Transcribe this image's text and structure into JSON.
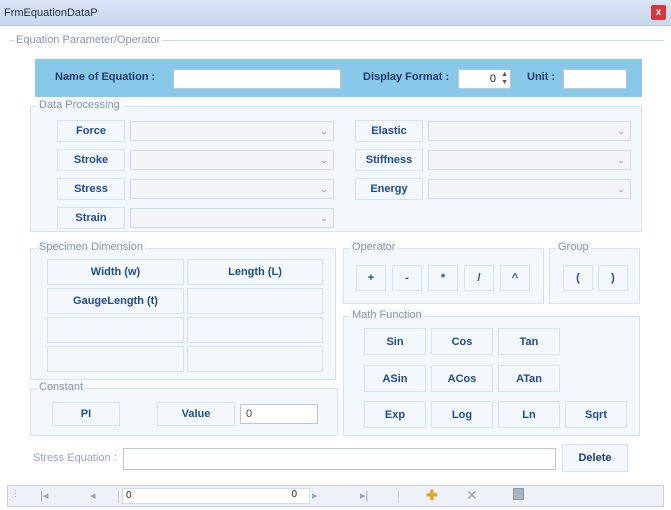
{
  "window": {
    "title": "FrmEquationDataP",
    "close_glyph": "x"
  },
  "equation_group": {
    "title": "Equation Parameter/Operator"
  },
  "header": {
    "name_label": "Name of Equation :",
    "name_value": "",
    "format_label": "Display Format :",
    "format_value": "0",
    "unit_label": "Unit :",
    "unit_value": ""
  },
  "data_processing": {
    "title": "Data Processing",
    "left": [
      "Force",
      "Stroke",
      "Stress",
      "Strain"
    ],
    "right": [
      "Elastic",
      "Stiffness",
      "Energy"
    ]
  },
  "specimen": {
    "title": "Specimen Dimension",
    "width": "Width (w)",
    "length": "Length (L)",
    "gauge": "GaugeLength (t)"
  },
  "operator": {
    "title": "Operator",
    "ops": [
      "+",
      "-",
      "*",
      "/",
      "^"
    ]
  },
  "group": {
    "title": "Group",
    "open": "(",
    "close": ")"
  },
  "math": {
    "title": "Math Function",
    "funcs": [
      "Sin",
      "Cos",
      "Tan",
      "ASin",
      "ACos",
      "ATan",
      "Exp",
      "Log",
      "Ln",
      "Sqrt"
    ]
  },
  "constant": {
    "title": "Constant",
    "pi": "PI",
    "value_label": "Value",
    "value": "0"
  },
  "footer": {
    "stress_label": "Stress Equation :",
    "stress_value": "",
    "delete": "Delete"
  },
  "navigator": {
    "position": "0",
    "count": "0"
  }
}
